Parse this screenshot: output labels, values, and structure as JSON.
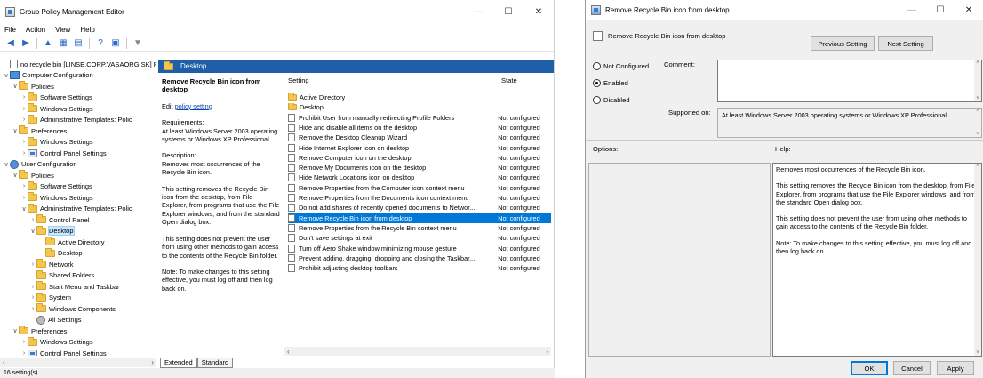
{
  "gpe": {
    "title": "Group Policy Management Editor",
    "window_controls": {
      "min": "—",
      "max": "☐",
      "close": "✕"
    },
    "menu": [
      "File",
      "Action",
      "View",
      "Help"
    ],
    "tree": [
      {
        "label": "no recycle bin [LINSE.CORP.VASAORG.SK] Policy",
        "icon": "doc-icon",
        "depth": 0,
        "chev": ""
      },
      {
        "label": "Computer Configuration",
        "icon": "computer-icon",
        "depth": 0,
        "chev": "∨"
      },
      {
        "label": "Policies",
        "icon": "folder-icon",
        "depth": 1,
        "chev": "∨"
      },
      {
        "label": "Software Settings",
        "icon": "folder-icon",
        "depth": 2,
        "chev": "›"
      },
      {
        "label": "Windows Settings",
        "icon": "folder-icon",
        "depth": 2,
        "chev": "›"
      },
      {
        "label": "Administrative Templates: Polic",
        "icon": "folder-icon",
        "depth": 2,
        "chev": "›"
      },
      {
        "label": "Preferences",
        "icon": "folder-icon",
        "depth": 1,
        "chev": "∨"
      },
      {
        "label": "Windows Settings",
        "icon": "folder-icon",
        "depth": 2,
        "chev": "›"
      },
      {
        "label": "Control Panel Settings",
        "icon": "control-panel-icon",
        "depth": 2,
        "chev": "›"
      },
      {
        "label": "User Configuration",
        "icon": "user-icon",
        "depth": 0,
        "chev": "∨"
      },
      {
        "label": "Policies",
        "icon": "folder-icon",
        "depth": 1,
        "chev": "∨"
      },
      {
        "label": "Software Settings",
        "icon": "folder-icon",
        "depth": 2,
        "chev": "›"
      },
      {
        "label": "Windows Settings",
        "icon": "folder-icon",
        "depth": 2,
        "chev": "›"
      },
      {
        "label": "Administrative Templates: Polic",
        "icon": "folder-icon",
        "depth": 2,
        "chev": "∨"
      },
      {
        "label": "Control Panel",
        "icon": "folder-icon",
        "depth": 3,
        "chev": "›"
      },
      {
        "label": "Desktop",
        "icon": "folder-icon",
        "depth": 3,
        "chev": "∨",
        "selected": true
      },
      {
        "label": "Active Directory",
        "icon": "folder-icon",
        "depth": 4,
        "chev": ""
      },
      {
        "label": "Desktop",
        "icon": "folder-icon",
        "depth": 4,
        "chev": ""
      },
      {
        "label": "Network",
        "icon": "folder-icon",
        "depth": 3,
        "chev": "›"
      },
      {
        "label": "Shared Folders",
        "icon": "folder-icon",
        "depth": 3,
        "chev": ""
      },
      {
        "label": "Start Menu and Taskbar",
        "icon": "folder-icon",
        "depth": 3,
        "chev": "›"
      },
      {
        "label": "System",
        "icon": "folder-icon",
        "depth": 3,
        "chev": "›"
      },
      {
        "label": "Windows Components",
        "icon": "folder-icon",
        "depth": 3,
        "chev": "›"
      },
      {
        "label": "All Settings",
        "icon": "settings-icon",
        "depth": 3,
        "chev": ""
      },
      {
        "label": "Preferences",
        "icon": "folder-icon",
        "depth": 1,
        "chev": "∨"
      },
      {
        "label": "Windows Settings",
        "icon": "folder-icon",
        "depth": 2,
        "chev": "›"
      },
      {
        "label": "Control Panel Settings",
        "icon": "control-panel-icon",
        "depth": 2,
        "chev": "›"
      }
    ],
    "pane_title": "Desktop",
    "description": {
      "title": "Remove Recycle Bin icon from desktop",
      "edit_prefix": "Edit ",
      "edit_link": "policy setting",
      "requirements_label": "Requirements:",
      "requirements": "At least Windows Server 2003 operating systems or Windows XP Professional",
      "description_label": "Description:",
      "p1": "Removes most occurrences of the Recycle Bin icon.",
      "p2": "This setting removes the Recycle Bin icon from the desktop, from File Explorer, from programs that use the File Explorer windows, and from the standard Open dialog box.",
      "p3": "This setting does not prevent the user from using other methods to gain access to the contents of the Recycle Bin folder.",
      "p4": "Note: To make changes to this setting effective, you must log off and then log back on."
    },
    "list_headers": {
      "setting": "Setting",
      "state": "State"
    },
    "rows": [
      {
        "name": "Active Directory",
        "state": "",
        "folder": true
      },
      {
        "name": "Desktop",
        "state": "",
        "folder": true
      },
      {
        "name": "Prohibit User from manually redirecting Profile Folders",
        "state": "Not configured"
      },
      {
        "name": "Hide and disable all items on the desktop",
        "state": "Not configured"
      },
      {
        "name": "Remove the Desktop Cleanup Wizard",
        "state": "Not configured"
      },
      {
        "name": "Hide Internet Explorer icon on desktop",
        "state": "Not configured"
      },
      {
        "name": "Remove Computer icon on the desktop",
        "state": "Not configured"
      },
      {
        "name": "Remove My Documents icon on the desktop",
        "state": "Not configured"
      },
      {
        "name": "Hide Network Locations icon on desktop",
        "state": "Not configured"
      },
      {
        "name": "Remove Properties from the Computer icon context menu",
        "state": "Not configured"
      },
      {
        "name": "Remove Properties from the Documents icon context menu",
        "state": "Not configured"
      },
      {
        "name": "Do not add shares of recently opened documents to Networ...",
        "state": "Not configured"
      },
      {
        "name": "Remove Recycle Bin icon from desktop",
        "state": "Not configured",
        "selected": true
      },
      {
        "name": "Remove Properties from the Recycle Bin context menu",
        "state": "Not configured"
      },
      {
        "name": "Don't save settings at exit",
        "state": "Not configured"
      },
      {
        "name": "Turn off Aero Shake window minimizing mouse gesture",
        "state": "Not configured"
      },
      {
        "name": "Prevent adding, dragging, dropping and closing the Taskbar...",
        "state": "Not configured"
      },
      {
        "name": "Prohibit adjusting desktop toolbars",
        "state": "Not configured"
      }
    ],
    "tabs": [
      "Extended",
      "Standard"
    ],
    "status": "16 setting(s)"
  },
  "dialog": {
    "title": "Remove Recycle Bin icon from desktop",
    "window_controls": {
      "min": "—",
      "max": "☐",
      "close": "✕"
    },
    "setting_name": "Remove Recycle Bin icon from desktop",
    "prev_button": "Previous Setting",
    "next_button": "Next Setting",
    "radio_not_configured": "Not Configured",
    "radio_enabled": "Enabled",
    "radio_disabled": "Disabled",
    "selected_radio": "Enabled",
    "comment_label": "Comment:",
    "supported_label": "Supported on:",
    "supported_value": "At least Windows Server 2003 operating systems or Windows XP Professional",
    "options_label": "Options:",
    "help_label": "Help:",
    "help_p1": "Removes most occurrences of the Recycle Bin icon.",
    "help_p2": "This setting removes the Recycle Bin icon from the desktop, from File Explorer, from programs that use the File Explorer windows, and from the standard Open dialog box.",
    "help_p3": "This setting does not prevent the user from using other methods to gain access to the contents of the Recycle Bin folder.",
    "help_p4": "Note: To make changes to this setting effective, you must log off and then log back on.",
    "ok_button": "OK",
    "cancel_button": "Cancel",
    "apply_button": "Apply"
  }
}
